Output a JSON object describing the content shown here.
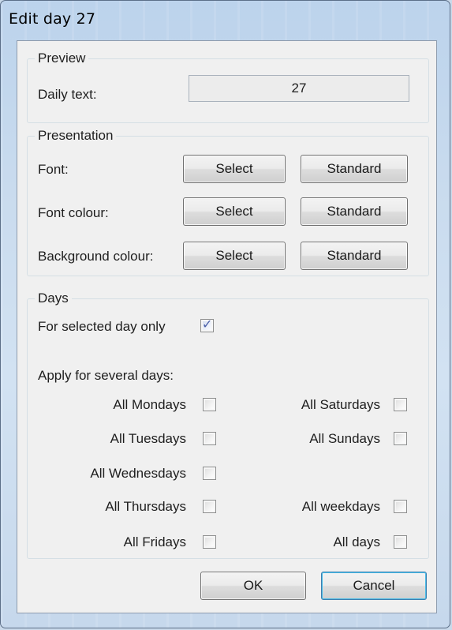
{
  "window": {
    "title": "Edit day 27"
  },
  "preview": {
    "legend": "Preview",
    "daily_text_label": "Daily text:",
    "daily_text_value": "27"
  },
  "presentation": {
    "legend": "Presentation",
    "rows": [
      {
        "label": "Font:",
        "select": "Select",
        "standard": "Standard"
      },
      {
        "label": "Font colour:",
        "select": "Select",
        "standard": "Standard"
      },
      {
        "label": "Background colour:",
        "select": "Select",
        "standard": "Standard"
      }
    ]
  },
  "days": {
    "legend": "Days",
    "selected_only": {
      "label": "For selected day only",
      "checked": true
    },
    "apply_label": "Apply for several days:",
    "left": [
      {
        "label": "All Mondays",
        "checked": false
      },
      {
        "label": "All Tuesdays",
        "checked": false
      },
      {
        "label": "All Wednesdays",
        "checked": false
      },
      {
        "label": "All Thursdays",
        "checked": false
      },
      {
        "label": "All Fridays",
        "checked": false
      }
    ],
    "right": [
      {
        "label": "All Saturdays",
        "checked": false
      },
      {
        "label": "All Sundays",
        "checked": false
      },
      {
        "label": "All weekdays",
        "checked": false
      },
      {
        "label": "All days",
        "checked": false
      }
    ]
  },
  "buttons": {
    "ok": "OK",
    "cancel": "Cancel"
  },
  "icons": {
    "checkmark": "checkmark-icon"
  }
}
